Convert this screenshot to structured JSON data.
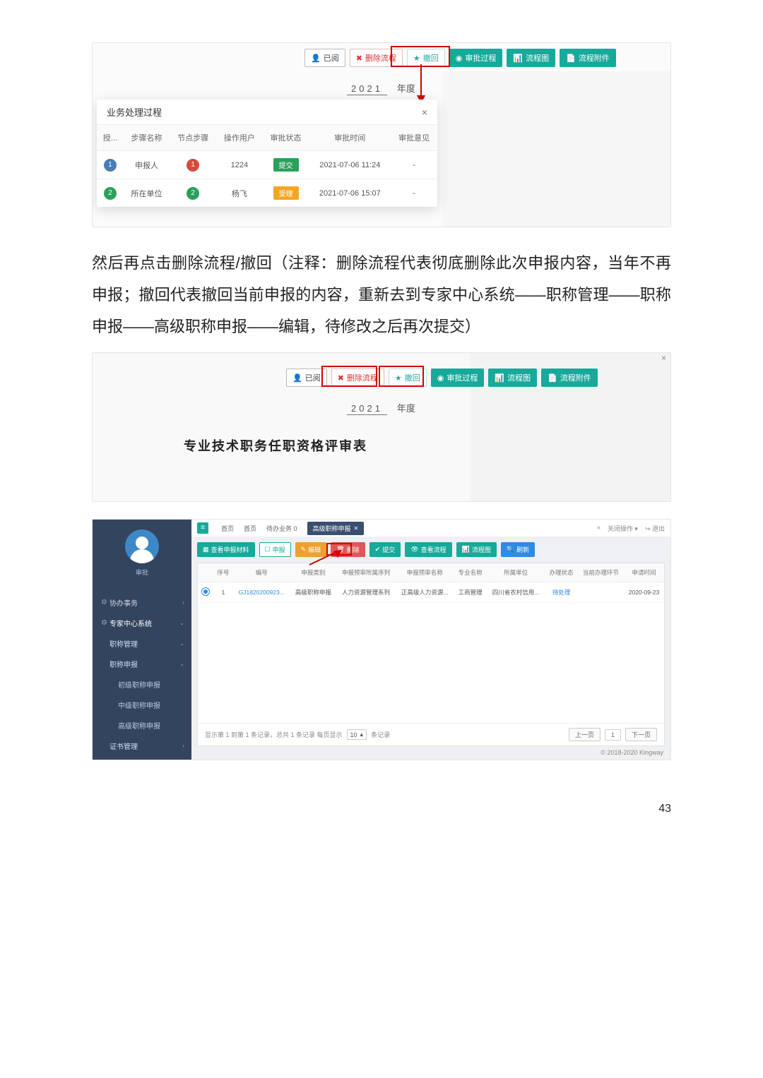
{
  "page_number": "43",
  "paragraph": "然后再点击删除流程/撤回（注释：删除流程代表彻底删除此次申报内容，当年不再申报；撤回代表撤回当前申报的内容，重新去到专家中心系统——职称管理——职称申报——高级职称申报——编辑，待修改之后再次提交）",
  "shot1": {
    "toolbar": [
      "已阅",
      "删除流程",
      "撤回",
      "审批过程",
      "流程图",
      "流程附件"
    ],
    "year_value": "2021",
    "year_label": "年度",
    "modal_title": "业务处理过程",
    "modal_close": "×",
    "columns": [
      "授...",
      "步骤名称",
      "节点步骤",
      "操作用户",
      "审批状态",
      "审批时间",
      "审批意见"
    ],
    "rows": [
      {
        "idx_class": "b1",
        "idx": "1",
        "step": "申报人",
        "node_class": "br",
        "node": "1",
        "user": "1224",
        "status_class": "gr",
        "status": "提交",
        "time": "2021-07-06 11:24",
        "opinion": "-"
      },
      {
        "idx_class": "b2",
        "idx": "2",
        "step": "所在单位",
        "node_class": "b2",
        "node": "2",
        "user": "杨飞",
        "status_class": "or",
        "status": "受理",
        "time": "2021-07-06 15:07",
        "opinion": "-"
      }
    ]
  },
  "shot2": {
    "toolbar": [
      "已阅",
      "删除流程",
      "撤回",
      "审批过程",
      "流程图",
      "流程附件"
    ],
    "year_value": "2021",
    "year_label": "年度",
    "title": "专业技术职务任职资格评审表",
    "close": "×"
  },
  "shot3": {
    "username": "审批",
    "menu": {
      "m1": "协办事务",
      "m2": "专家中心系统",
      "m2a": "职称管理",
      "m2a1": "职称申报",
      "m2a1a": "初级职称申报",
      "m2a1b": "中级职称申报",
      "m2a1c": "高级职称申报",
      "m2b": "证书管理"
    },
    "topbar": {
      "home": "首页",
      "todo": "待办业务 0",
      "tab": "高级职称申报",
      "close_op": "关闭操作",
      "logout": "退出"
    },
    "toolbar": [
      "查看申报材料",
      "申报",
      "编辑",
      "删除",
      "提交",
      "查看流程",
      "流程图",
      "刷新"
    ],
    "columns": [
      "",
      "序号",
      "编号",
      "申报类别",
      "申报预审所属序列",
      "申报预审名称",
      "专业名称",
      "所属单位",
      "办理状态",
      "当前办理环节",
      "申请时间"
    ],
    "row": {
      "seq": "1",
      "code": "GJ1820200923...",
      "type": "高级职称申报",
      "series": "人力资源管理系列",
      "name": "正高级人力资源...",
      "major": "工商管理",
      "org": "四川省农村信用...",
      "status": "待处理",
      "node": "",
      "time": "2020-09-23"
    },
    "footer": {
      "summary_a": "显示第 1 到第 1 条记录，总共 1 条记录 每页显示",
      "per": "10",
      "summary_b": "条记录",
      "prev": "上一页",
      "page": "1",
      "next": "下一页"
    },
    "copyright": "© 2018-2020 Kingway"
  }
}
